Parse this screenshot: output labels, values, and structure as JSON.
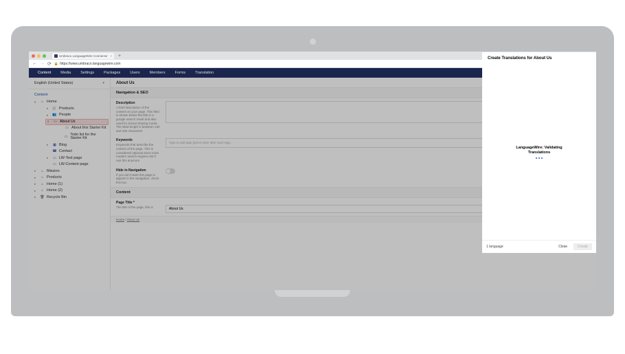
{
  "browser": {
    "tab_title": "Umbraco LanguageWire Connector",
    "url": "https://www.umbraco.languagewire.com"
  },
  "nav": {
    "items": [
      "Content",
      "Media",
      "Settings",
      "Packages",
      "Users",
      "Members",
      "Forms",
      "Translation"
    ],
    "active_index": 0
  },
  "sidebar": {
    "language_label": "English (United States)",
    "section_label": "Content",
    "tree": {
      "home": "Home",
      "products": "Products",
      "people": "People",
      "about": "About Us",
      "about_children": [
        "About this Starter Kit",
        "Todo list for the Starter Kit"
      ],
      "blog": "Blog",
      "contact": "Contact",
      "test_page": "LW-Test page",
      "content_page": "LW-Content page",
      "mission": "Mission",
      "products2": "Products",
      "home1": "Home (1)",
      "home2": "Home (2)",
      "recycle": "Recycle Bin"
    }
  },
  "main": {
    "title": "About Us",
    "sections": {
      "nav_seo": "Navigation & SEO",
      "content": "Content"
    },
    "fields": {
      "description": {
        "name": "Description",
        "hint": "A brief description of the content on your page. This field is shown below the title in a google search result and also used for Social Sharing Cards. The ideal length is between 130 and 155 characters"
      },
      "keywords": {
        "name": "Keywords",
        "hint": "Keywords that describe the content of the page. This is considered optional since most modern search engines don't use this anymore",
        "placeholder": "Type to add tags (press enter after each tag)..."
      },
      "hide": {
        "name": "Hide in Navigation",
        "hint": "If you don't want this page to appear in the navigation, check this box"
      },
      "page_title": {
        "name": "Page Title",
        "hint": "The title of the page, this is",
        "value": "About Us"
      }
    },
    "breadcrumb": [
      "Home",
      "About Us"
    ]
  },
  "panel": {
    "title": "Create Translations for About Us",
    "status_line1": "LanguageWire: Validating",
    "status_line2": "Translations",
    "language_count": "1 language",
    "close_label": "Close",
    "create_label": "Create"
  }
}
